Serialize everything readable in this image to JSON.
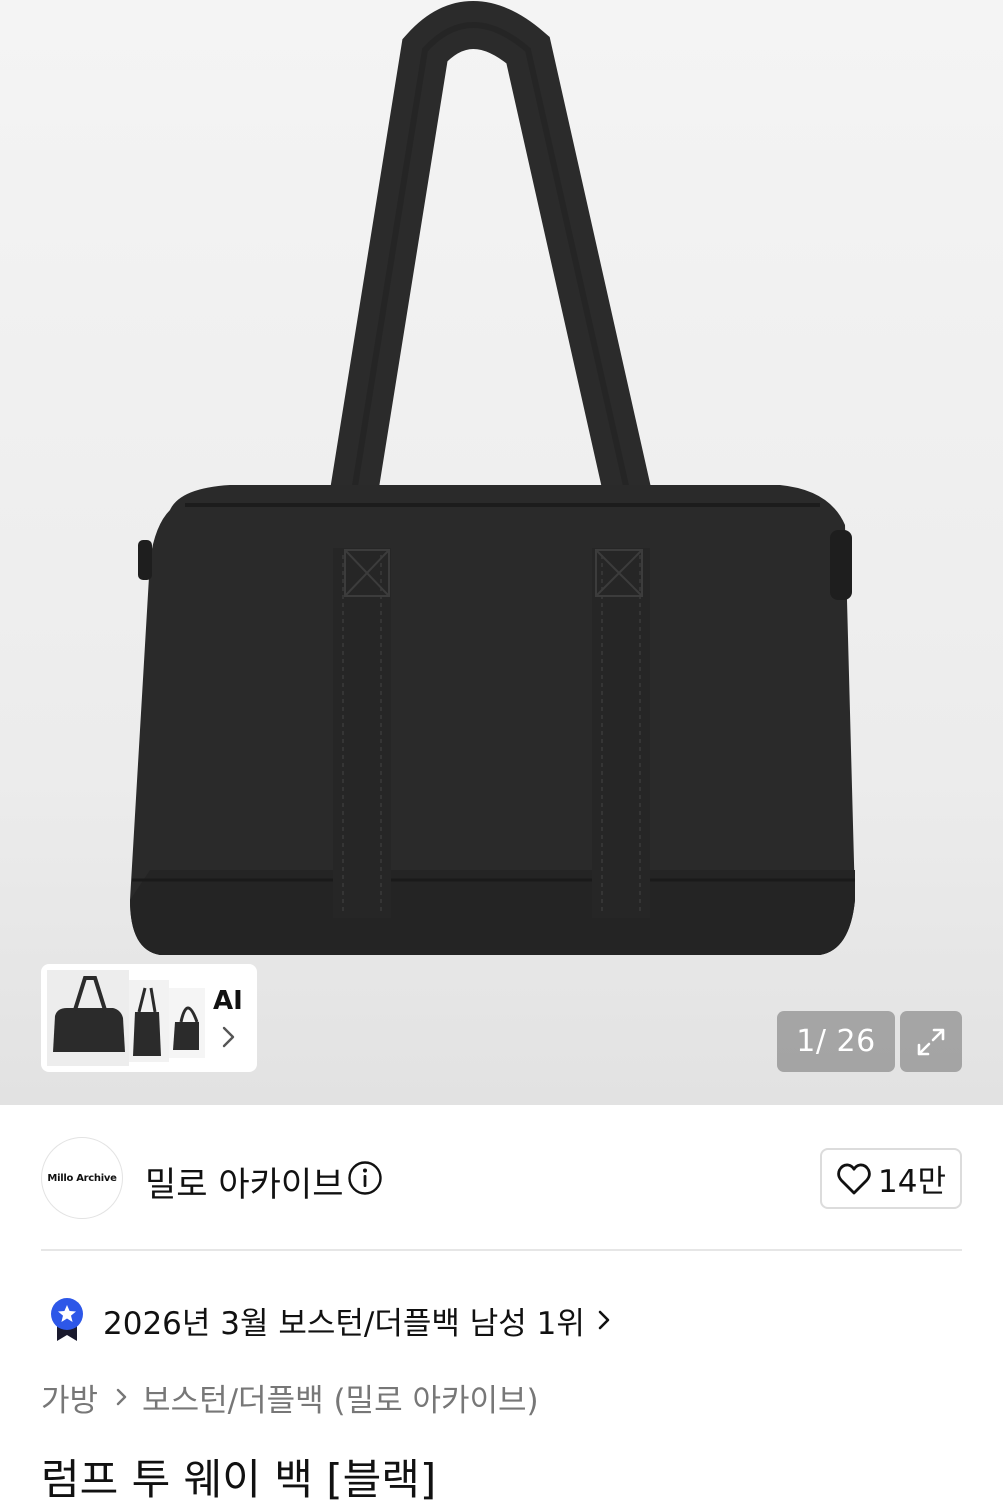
{
  "product": {
    "title": "럼프 투 웨이 백 [블랙]",
    "image_counter": "1/ 26",
    "ai_label": "AI"
  },
  "brand": {
    "logo_text": "Millo Archive",
    "name": "밀로 아카이브",
    "like_count": "14만"
  },
  "ranking": {
    "text": "2026년 3월 보스턴/더플백 남성 1위"
  },
  "breadcrumb": {
    "items": [
      "가방",
      "보스턴/더플백 (밀로 아카이브)"
    ]
  },
  "icons": {
    "info": "info-icon",
    "heart": "heart-icon",
    "expand": "expand-icon",
    "rank_badge": "ranking-badge-icon"
  },
  "colors": {
    "rank_badge_blue": "#2d57e8",
    "rank_badge_dark": "#1a1a2e",
    "counter_bg": "#8c8c8c"
  }
}
